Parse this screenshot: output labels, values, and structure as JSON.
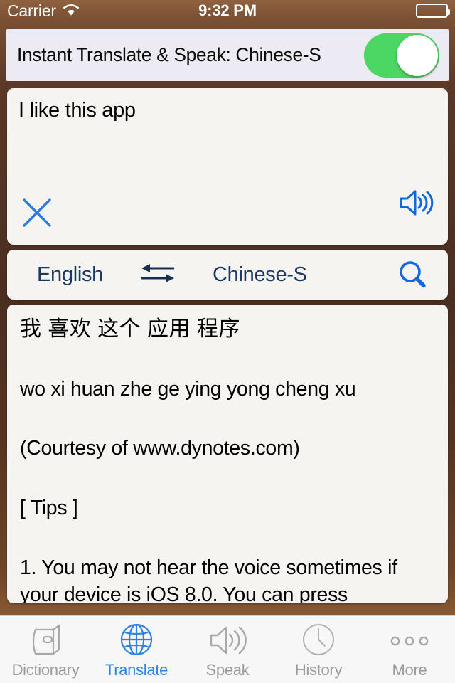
{
  "statusbar": {
    "carrier": "Carrier",
    "wifi_icon": "wifi-icon",
    "time": "9:32 PM",
    "battery_icon": "battery-icon"
  },
  "header": {
    "title": "Instant Translate & Speak: Chinese-S",
    "toggle_state": "on",
    "toggle_color": "#4CD764"
  },
  "input": {
    "text": "I like this app",
    "speak_icon": "speaker-icon",
    "clear_icon": "close-x-icon"
  },
  "language_bar": {
    "source": "English",
    "swap_icon": "swap-arrows-icon",
    "target": "Chinese-S",
    "search_icon": "search-icon",
    "text_color": "#1B3A63",
    "icon_color": "#1169E0"
  },
  "result": {
    "lines": [
      "我 喜欢 这个 应用 程序",
      "wo xi huan zhe ge ying yong cheng xu",
      "(Courtesy of www.dynotes.com)",
      "[ Tips ]",
      "1. You may not hear the voice sometimes if your device is iOS 8.0. You can press"
    ]
  },
  "tabbar": {
    "items": [
      {
        "label": "Dictionary",
        "icon": "dictionary-book-icon",
        "active": false
      },
      {
        "label": "Translate",
        "icon": "globe-icon",
        "active": true
      },
      {
        "label": "Speak",
        "icon": "speaker-icon",
        "active": false
      },
      {
        "label": "History",
        "icon": "clock-icon",
        "active": false
      },
      {
        "label": "More",
        "icon": "ellipsis-icon",
        "active": false
      }
    ],
    "active_color": "#2B84E8",
    "inactive_color": "#9A9A9A"
  }
}
